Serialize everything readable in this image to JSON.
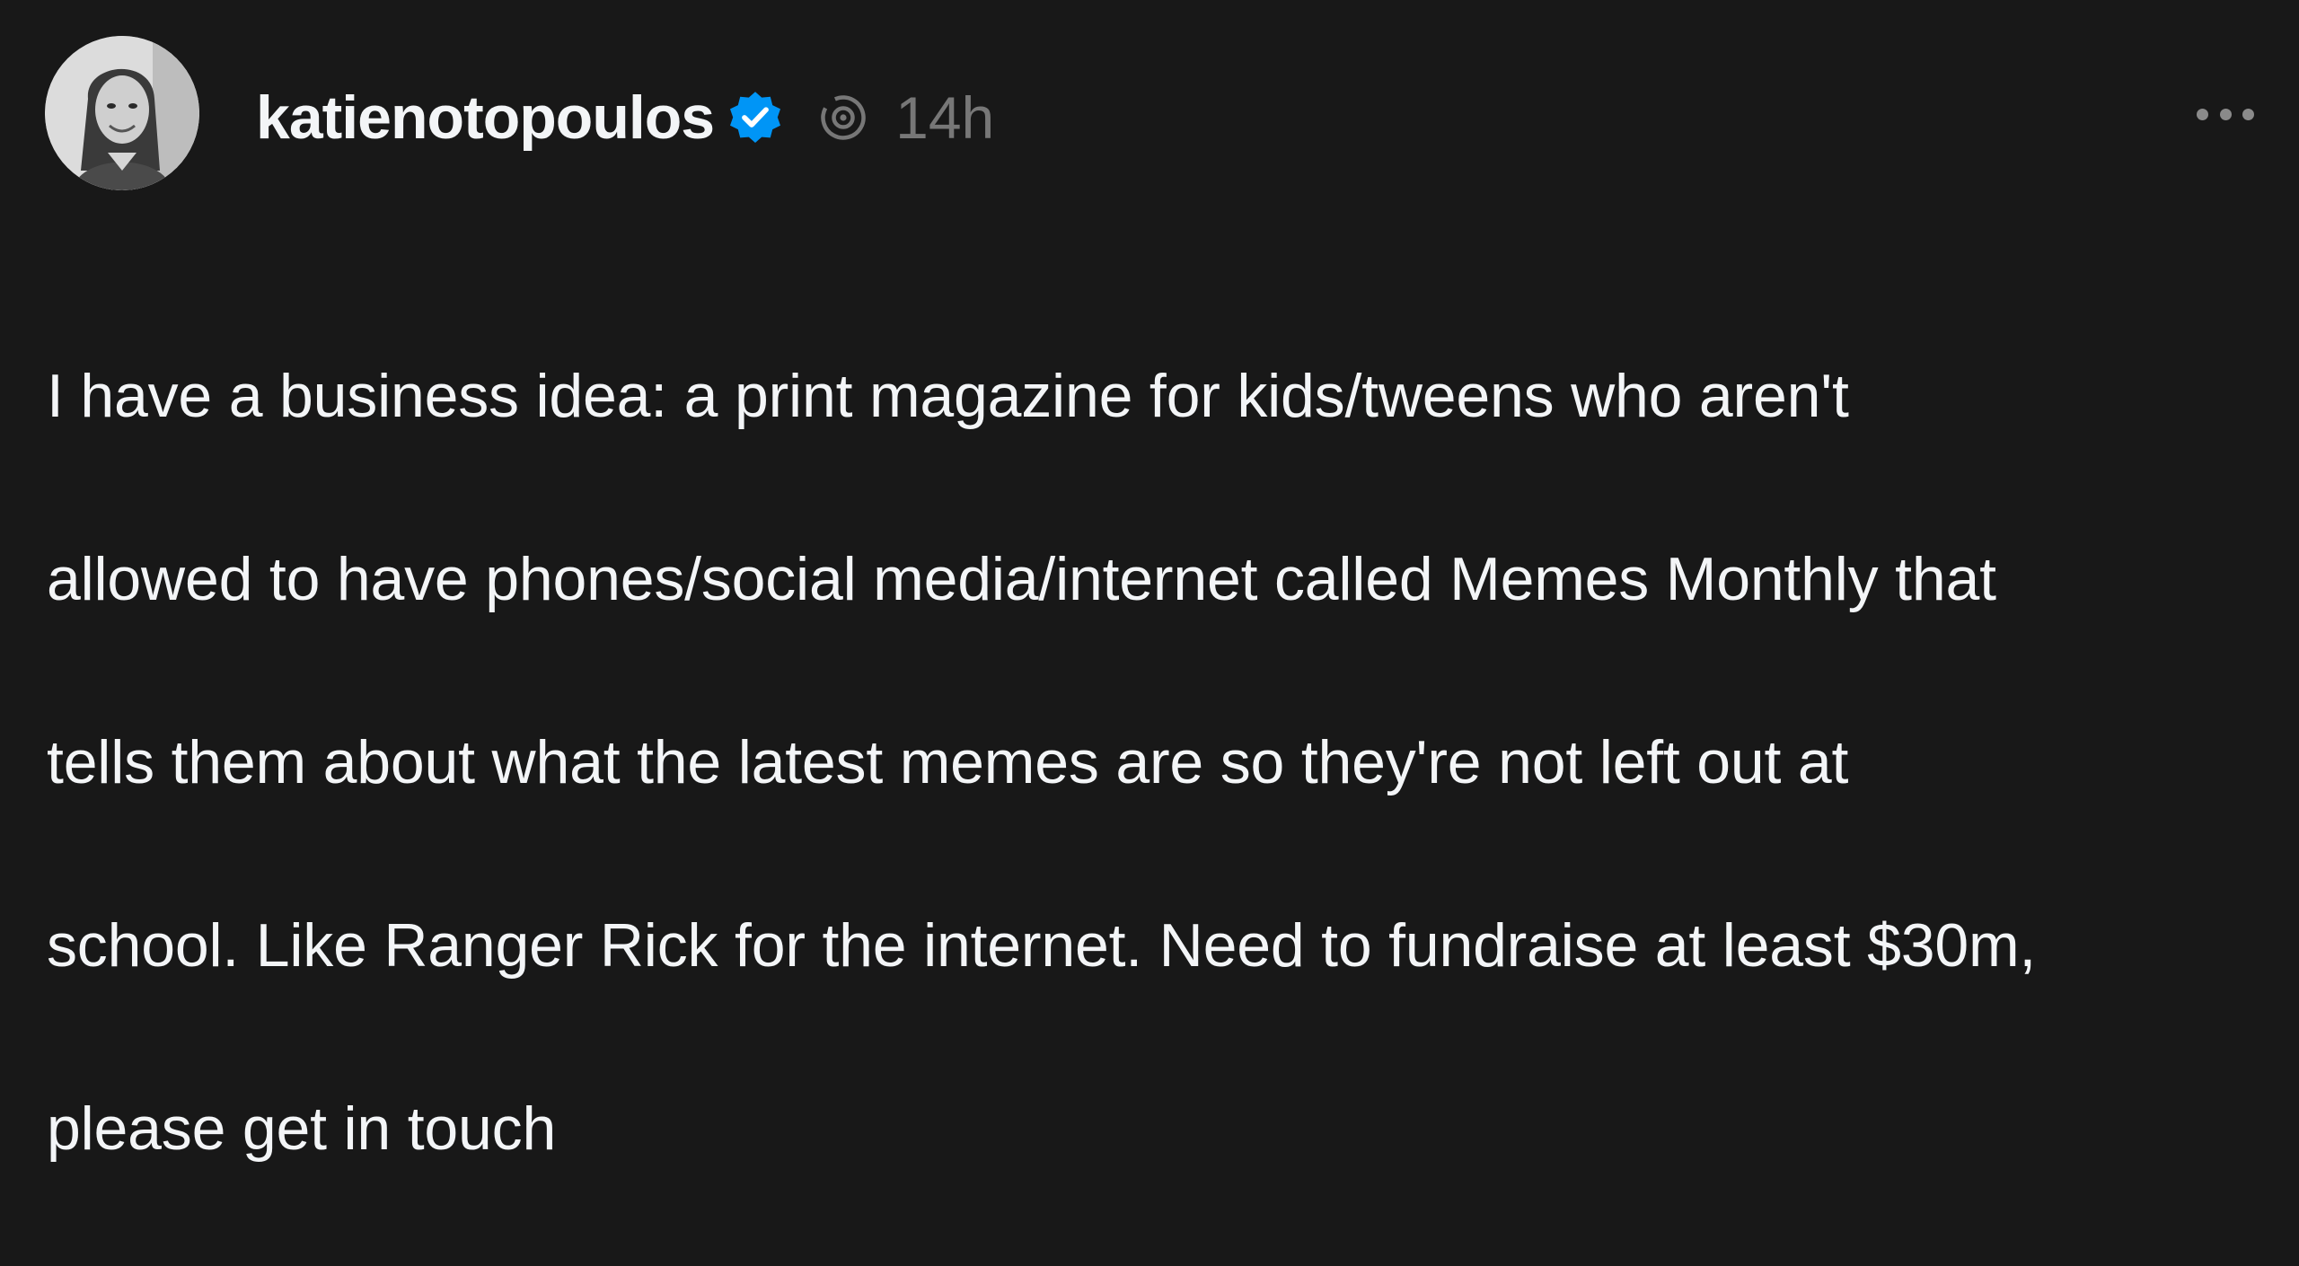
{
  "post": {
    "author": {
      "username": "katienotopoulos",
      "verified": true,
      "avatar_icon": "profile-photo"
    },
    "timestamp": "14h",
    "menu_icon": "more-horizontal-icon",
    "text_lines": [
      "I have a business idea: a print magazine for kids/tweens who aren't",
      "allowed to have phones/social media/internet called Memes Monthly that",
      "tells them about what the latest memes are so they're not left out at",
      "school. Like Ranger Rick for the internet. Need to fundraise at least $30m,",
      "please get in touch"
    ]
  },
  "colors": {
    "background": "#181818",
    "text": "#f3f5f7",
    "muted": "#777777",
    "verified_blue": "#0095f6"
  }
}
